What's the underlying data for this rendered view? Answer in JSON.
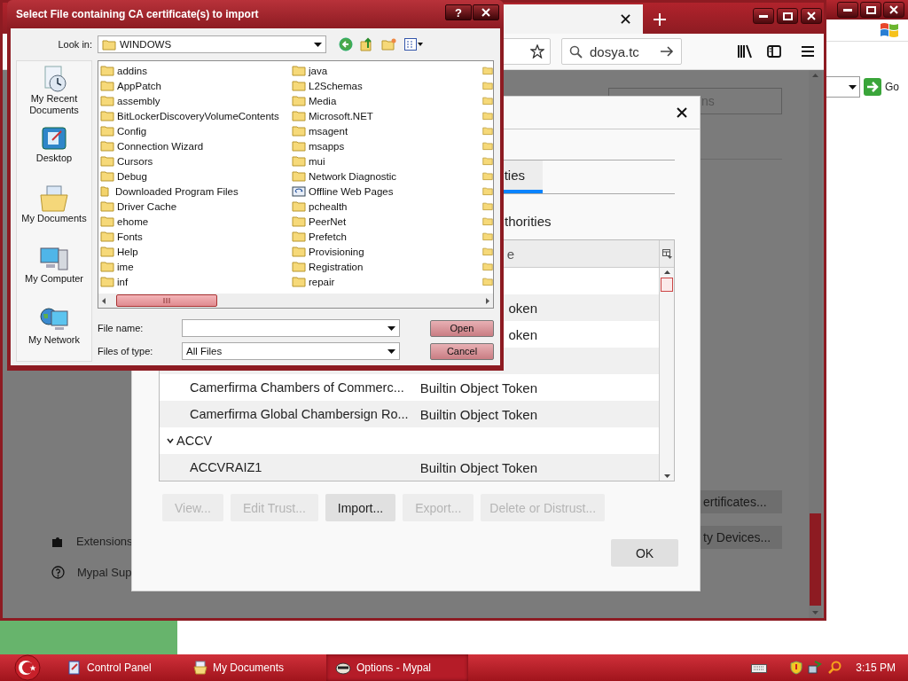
{
  "background_window": {
    "go": "Go"
  },
  "browser": {
    "search": {
      "value": "dosya.tc"
    },
    "page": {
      "search_field": "ns",
      "sidebar": [
        {
          "kind": "extensions",
          "label": "Extensions"
        },
        {
          "kind": "support",
          "label": "Mypal Sup"
        }
      ],
      "buttons": [
        "ertificates...",
        "ty Devices..."
      ]
    }
  },
  "cert_manager": {
    "tabs": [
      {
        "label": "ties",
        "selected": true
      }
    ],
    "heading": "thorities",
    "columns": [
      "e"
    ],
    "rows": [
      {
        "kind": "cert",
        "token": "oken"
      },
      {
        "kind": "cert",
        "token": "oken"
      },
      {
        "kind": "cert"
      },
      {
        "kind": "cert",
        "name": "Camerfirma Chambers of Commerc...",
        "token": "Builtin Object Token"
      },
      {
        "kind": "cert",
        "name": "Camerfirma Global Chambersign Ro...",
        "token": "Builtin Object Token"
      },
      {
        "kind": "group",
        "name": "ACCV",
        "expanded": true
      },
      {
        "kind": "cert",
        "name": "ACCVRAIZ1",
        "token": "Builtin Object Token"
      }
    ],
    "buttons": [
      {
        "label": "View...",
        "disabled": true
      },
      {
        "label": "Edit Trust...",
        "disabled": true
      },
      {
        "label": "Import...",
        "disabled": false
      },
      {
        "label": "Export...",
        "disabled": true
      },
      {
        "label": "Delete or Distrust...",
        "disabled": true
      }
    ],
    "ok": "OK"
  },
  "file_dialog": {
    "title": "Select File containing CA certificate(s) to import",
    "help": "?",
    "look_in": {
      "label": "Look in:",
      "value": "WINDOWS"
    },
    "places": [
      {
        "kind": "recent",
        "label": "My Recent Documents"
      },
      {
        "kind": "desktop",
        "label": "Desktop"
      },
      {
        "kind": "documents",
        "label": "My Documents"
      },
      {
        "kind": "computer",
        "label": "My Computer"
      },
      {
        "kind": "network",
        "label": "My Network"
      }
    ],
    "folders": [
      [
        {
          "name": "addins",
          "kind": "folder"
        },
        {
          "name": "AppPatch",
          "kind": "folder"
        },
        {
          "name": "assembly",
          "kind": "folder"
        },
        {
          "name": "BitLockerDiscoveryVolumeContents",
          "kind": "folder"
        },
        {
          "name": "Config",
          "kind": "folder"
        },
        {
          "name": "Connection Wizard",
          "kind": "folder"
        },
        {
          "name": "Cursors",
          "kind": "folder"
        },
        {
          "name": "Debug",
          "kind": "folder"
        },
        {
          "name": "Downloaded Program Files",
          "kind": "special"
        },
        {
          "name": "Driver Cache",
          "kind": "folder"
        },
        {
          "name": "ehome",
          "kind": "folder"
        },
        {
          "name": "Fonts",
          "kind": "folder"
        },
        {
          "name": "Help",
          "kind": "folder"
        },
        {
          "name": "ime",
          "kind": "folder"
        },
        {
          "name": "inf",
          "kind": "folder"
        }
      ],
      [
        {
          "name": "java",
          "kind": "folder"
        },
        {
          "name": "L2Schemas",
          "kind": "folder"
        },
        {
          "name": "Media",
          "kind": "folder"
        },
        {
          "name": "Microsoft.NET",
          "kind": "folder"
        },
        {
          "name": "msagent",
          "kind": "folder"
        },
        {
          "name": "msapps",
          "kind": "folder"
        },
        {
          "name": "mui",
          "kind": "folder"
        },
        {
          "name": "Network Diagnostic",
          "kind": "folder"
        },
        {
          "name": "Offline Web Pages",
          "kind": "offline"
        },
        {
          "name": "pchealth",
          "kind": "folder"
        },
        {
          "name": "PeerNet",
          "kind": "folder"
        },
        {
          "name": "Prefetch",
          "kind": "folder"
        },
        {
          "name": "Provisioning",
          "kind": "folder"
        },
        {
          "name": "Registration",
          "kind": "folder"
        },
        {
          "name": "repair",
          "kind": "folder"
        }
      ]
    ],
    "file_name": {
      "label": "File name:"
    },
    "file_type": {
      "label": "Files of type:",
      "value": "All Files"
    },
    "buttons": [
      "Open",
      "Cancel"
    ]
  },
  "taskbar": {
    "tasks": [
      {
        "kind": "panel",
        "label": "Control Panel",
        "selected": false
      },
      {
        "kind": "documents",
        "label": "My Documents",
        "selected": false
      },
      {
        "kind": "browser",
        "label": "Options - Mypal",
        "selected": true
      }
    ],
    "clock": "3:15 PM"
  }
}
